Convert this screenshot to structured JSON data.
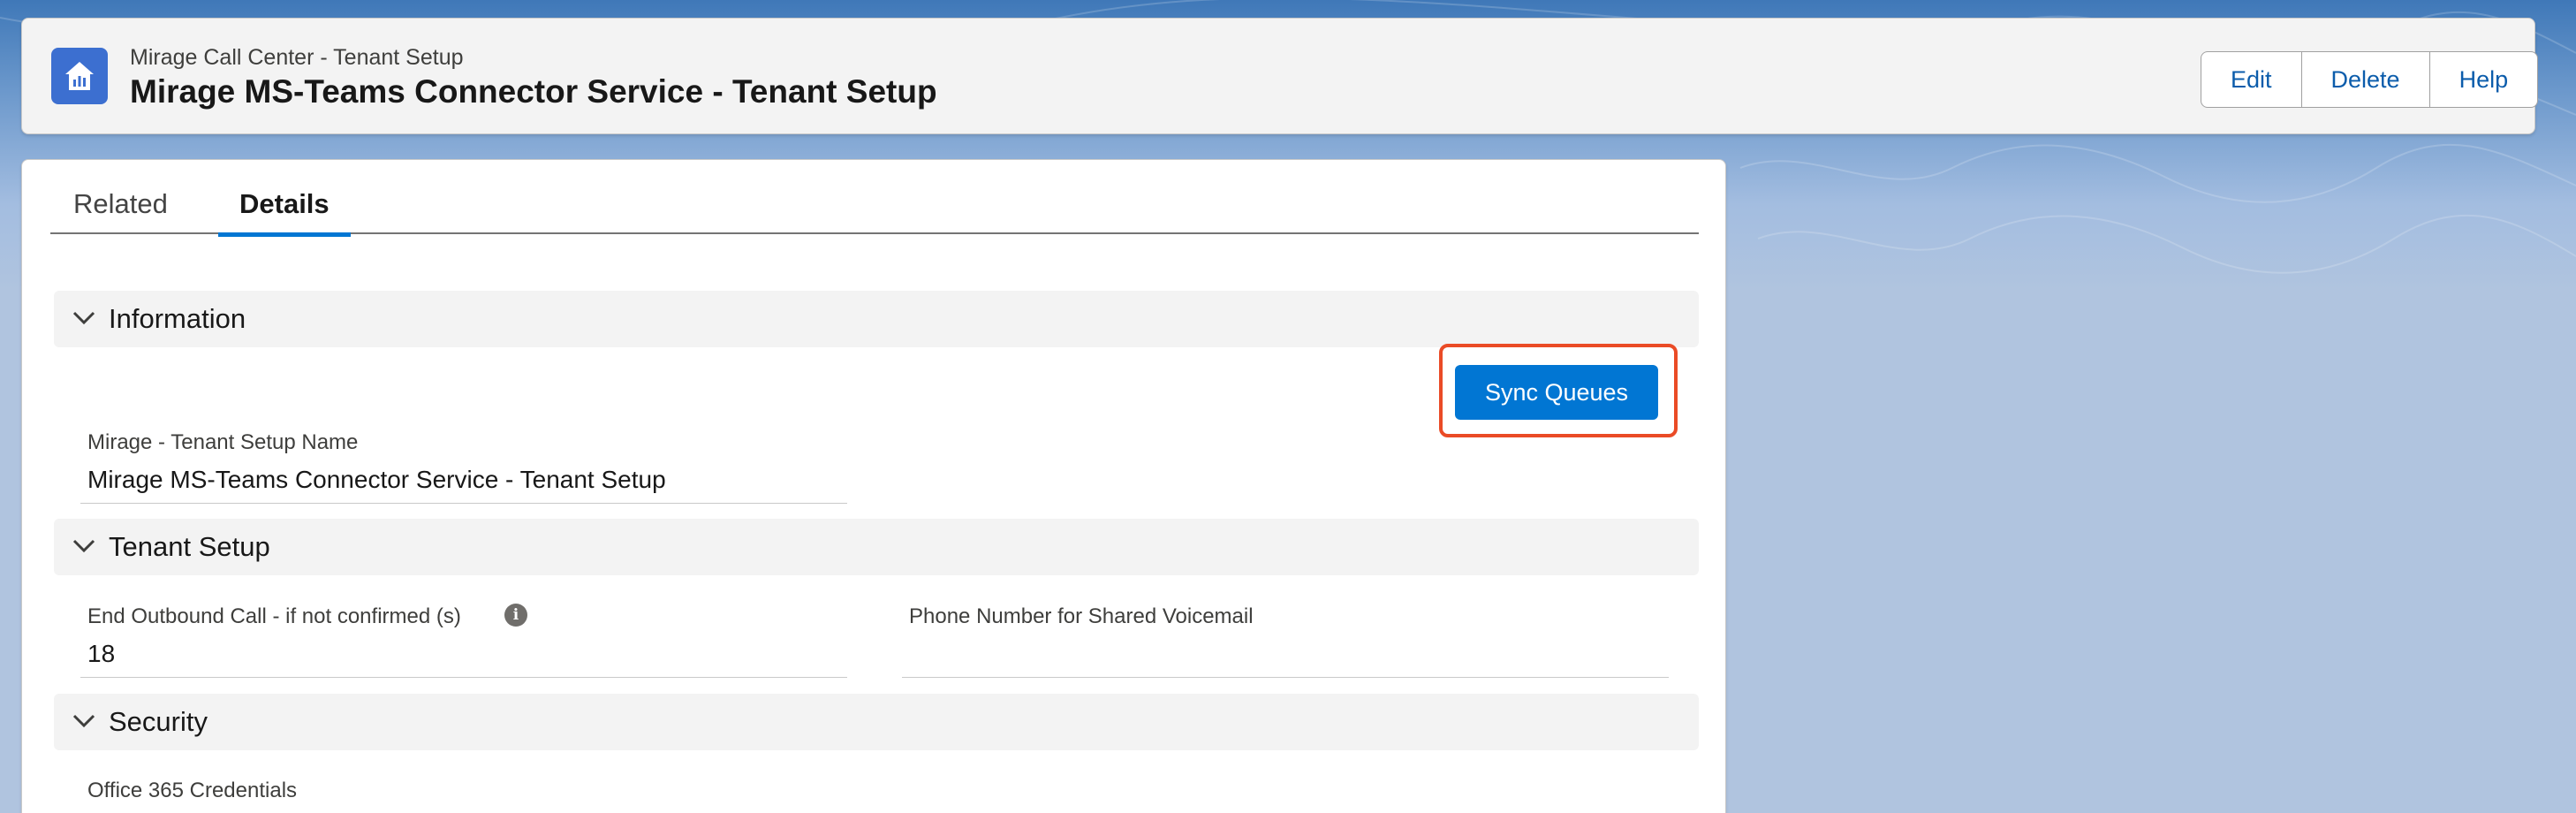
{
  "header": {
    "subtitle": "Mirage Call Center - Tenant Setup",
    "title": "Mirage MS-Teams Connector Service - Tenant Setup",
    "icon": "home-chart-icon",
    "actions": {
      "edit": "Edit",
      "delete": "Delete",
      "help": "Help"
    }
  },
  "tabs": {
    "related": "Related",
    "details": "Details",
    "active": "Details"
  },
  "sections": {
    "information": {
      "label": "Information",
      "sync_button": "Sync Queues",
      "fields": {
        "name_label": "Mirage - Tenant Setup Name",
        "name_value": "Mirage MS-Teams Connector Service - Tenant Setup"
      }
    },
    "tenant_setup": {
      "label": "Tenant Setup",
      "fields": {
        "end_call_label": "End Outbound Call - if not confirmed (s)",
        "end_call_value": "18",
        "voicemail_label": "Phone Number for Shared Voicemail",
        "voicemail_value": ""
      }
    },
    "security": {
      "label": "Security",
      "fields": {
        "credentials_label": "Office 365 Credentials"
      }
    }
  },
  "colors": {
    "brand": "#0176d3",
    "highlight": "#ea4b26",
    "icon_bg": "#3c6fd0"
  }
}
